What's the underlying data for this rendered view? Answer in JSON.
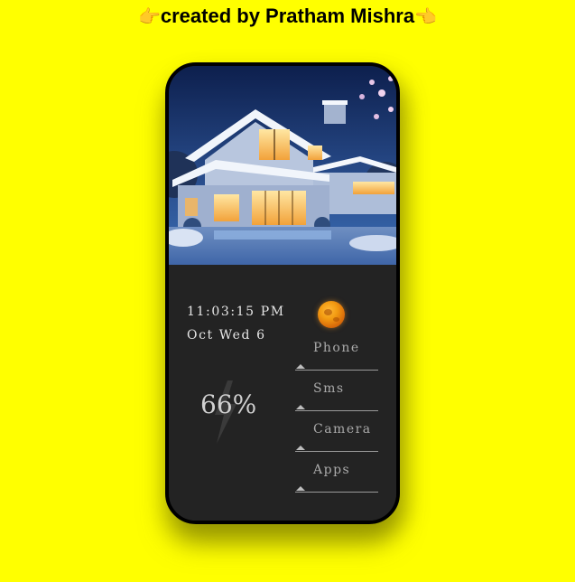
{
  "header": {
    "credit": "created by Pratham Mishra",
    "left_hand": "👉",
    "right_hand": "👈"
  },
  "lockscreen": {
    "time": "11:03:15 PM",
    "date": "Oct Wed 6",
    "battery_percent": "66%",
    "battery_level": 0.66
  },
  "apps": [
    {
      "label": "Phone"
    },
    {
      "label": "Sms"
    },
    {
      "label": "Camera"
    },
    {
      "label": "Apps"
    }
  ],
  "icons": {
    "moon": "moon-icon",
    "battery": "lightning-bolt-icon",
    "menu_marker": "triangle-up-icon"
  },
  "colors": {
    "background": "#ffff00",
    "phone_body": "#232323",
    "moon": "#f39c12",
    "text": "#e6e6e6",
    "app_text": "#aaaaaa"
  }
}
